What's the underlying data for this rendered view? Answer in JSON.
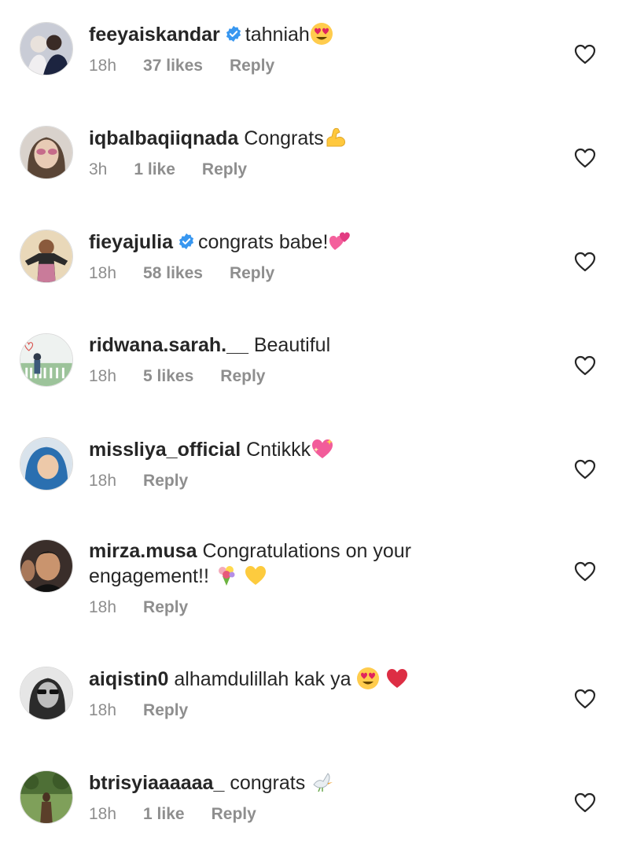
{
  "comments": [
    {
      "username": "feeyaiskandar",
      "verified": true,
      "text": "tahniah",
      "time": "18h",
      "likes": "37 likes",
      "reply": "Reply",
      "emojis": [
        "heart-eyes-emoji"
      ]
    },
    {
      "username": "iqbalbaqiiqnada",
      "verified": false,
      "text": "Congrats",
      "time": "3h",
      "likes": "1 like",
      "reply": "Reply",
      "emojis": [
        "flexed-biceps-emoji"
      ]
    },
    {
      "username": "fieyajulia",
      "verified": true,
      "text": "congrats babe!",
      "time": "18h",
      "likes": "58 likes",
      "reply": "Reply",
      "emojis": [
        "revolving-hearts-emoji"
      ]
    },
    {
      "username": "ridwana.sarah.__",
      "verified": false,
      "text": "Beautiful",
      "time": "18h",
      "likes": "5 likes",
      "reply": "Reply",
      "emojis": []
    },
    {
      "username": "missliya_official",
      "verified": false,
      "text": "Cntikkk",
      "time": "18h",
      "likes": "",
      "reply": "Reply",
      "emojis": [
        "sparkling-heart-emoji"
      ]
    },
    {
      "username": "mirza.musa",
      "verified": false,
      "text": "Congratulations on your engagement!!",
      "time": "18h",
      "likes": "",
      "reply": "Reply",
      "emojis": [
        "bouquet-emoji",
        "yellow-heart-emoji"
      ]
    },
    {
      "username": "aiqistin0",
      "verified": false,
      "text": "alhamdulillah kak ya",
      "time": "18h",
      "likes": "",
      "reply": "Reply",
      "emojis": [
        "heart-eyes-emoji",
        "red-heart-emoji"
      ]
    },
    {
      "username": "btrisyiaaaaaa_",
      "verified": false,
      "text": "congrats",
      "time": "18h",
      "likes": "1 like",
      "reply": "Reply",
      "emojis": [
        "dove-emoji"
      ]
    }
  ],
  "colors": {
    "text": "#262626",
    "meta": "#8e8e8e",
    "verified_badge": "#3897f0"
  },
  "icons": {
    "like": "heart-outline-icon",
    "verified": "verified-badge-icon"
  }
}
